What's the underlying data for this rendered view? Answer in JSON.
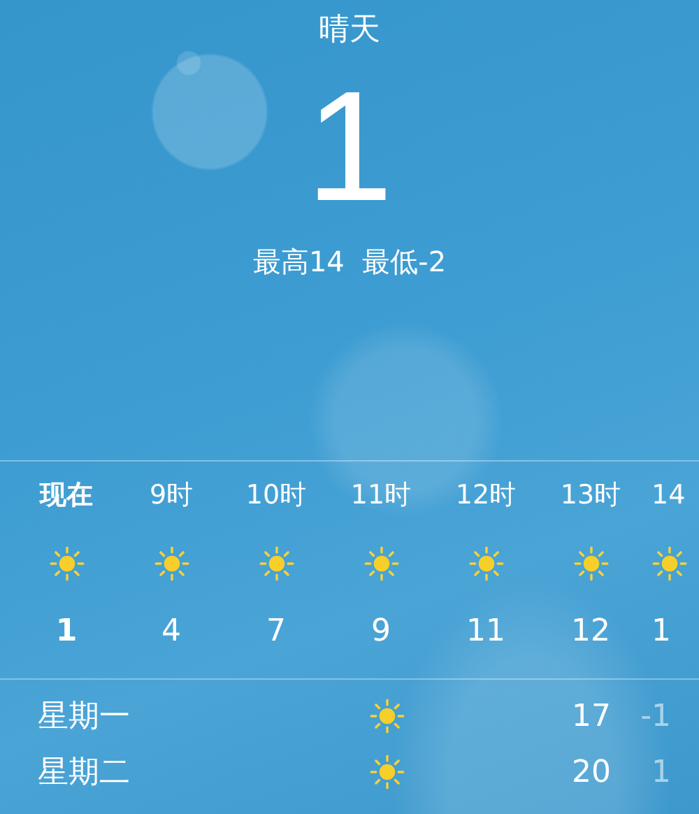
{
  "current": {
    "condition": "晴天",
    "temperature": "1",
    "high_low": "最高14  最低-2"
  },
  "hourly": [
    {
      "time": "现在",
      "temp": "1",
      "current": true,
      "kind": "sun"
    },
    {
      "time": "9时",
      "temp": "4",
      "current": false,
      "kind": "sun"
    },
    {
      "time": "10时",
      "temp": "7",
      "current": false,
      "kind": "sun"
    },
    {
      "time": "11时",
      "temp": "9",
      "current": false,
      "kind": "sun"
    },
    {
      "time": "12时",
      "temp": "11",
      "current": false,
      "kind": "sun"
    },
    {
      "time": "13时",
      "temp": "12",
      "current": false,
      "kind": "sun"
    },
    {
      "time": "14",
      "temp": "1",
      "current": false,
      "kind": "sun"
    }
  ],
  "daily": [
    {
      "day": "星期一",
      "kind": "sun",
      "high": "17",
      "low": "-1"
    },
    {
      "day": "星期二",
      "kind": "sun",
      "high": "20",
      "low": "1"
    }
  ]
}
